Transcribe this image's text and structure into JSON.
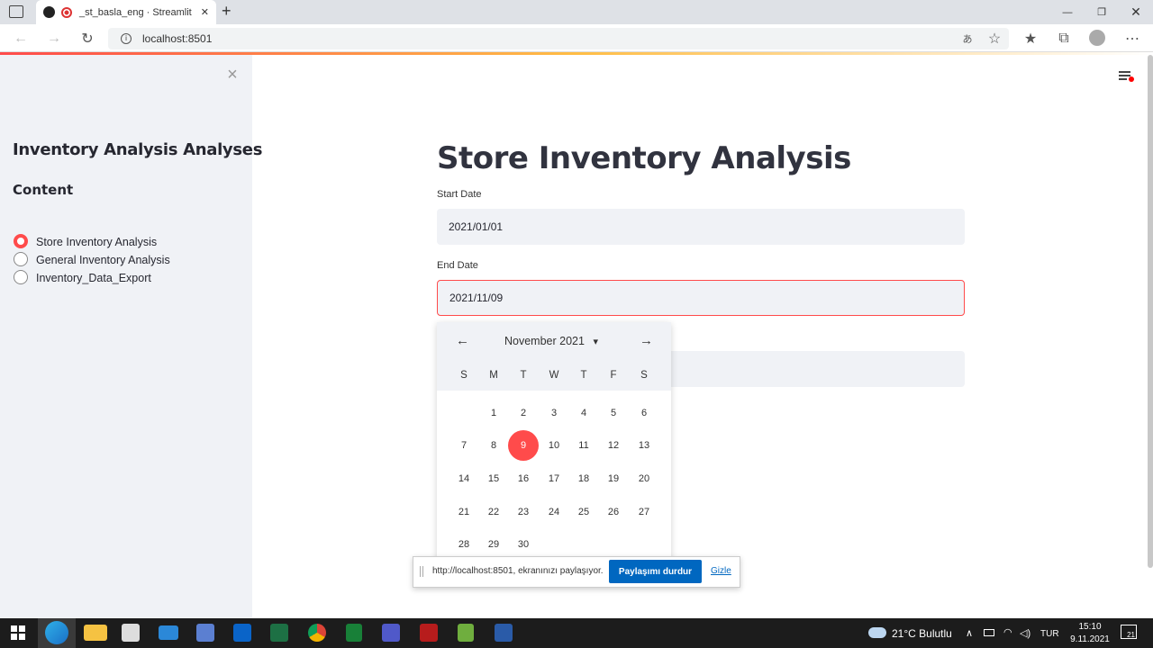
{
  "browser": {
    "tab_title": "_st_basla_eng · Streamlit",
    "url": "localhost:8501",
    "new_tab": "+",
    "minimize": "—",
    "maximize": "❐",
    "close": "✕"
  },
  "sidebar": {
    "title": "Inventory Analysis Analyses",
    "section": "Content",
    "close": "×",
    "options": [
      {
        "label": "Store Inventory Analysis",
        "selected": true
      },
      {
        "label": "General Inventory Analysis",
        "selected": false
      },
      {
        "label": "Inventory_Data_Export",
        "selected": false
      }
    ]
  },
  "main": {
    "title": "Store Inventory Analysis",
    "start_label": "Start Date",
    "start_value": "2021/01/01",
    "end_label": "End Date",
    "end_value": "2021/11/09"
  },
  "calendar": {
    "month": "November 2021",
    "prev": "←",
    "next": "→",
    "caret": "▾",
    "weekdays": [
      "S",
      "M",
      "T",
      "W",
      "T",
      "F",
      "S"
    ],
    "dates": [
      "1",
      "2",
      "3",
      "4",
      "5",
      "6",
      "7",
      "8",
      "9",
      "10",
      "11",
      "12",
      "13",
      "14",
      "15",
      "16",
      "17",
      "18",
      "19",
      "20",
      "21",
      "22",
      "23",
      "24",
      "25",
      "26",
      "27",
      "28",
      "29",
      "30"
    ],
    "selected": "9"
  },
  "share": {
    "text": "http://localhost:8501, ekranınızı paylaşıyor.",
    "stop": "Paylaşımı durdur",
    "hide": "Gizle"
  },
  "taskbar": {
    "weather": "21°C Bulutlu",
    "lang": "TUR",
    "time": "15:10",
    "date": "9.11.2021",
    "notif": "21"
  },
  "colors": {
    "accent": "#ff4b4b",
    "sidebar_bg": "#f0f2f6",
    "link": "#0067c0"
  }
}
